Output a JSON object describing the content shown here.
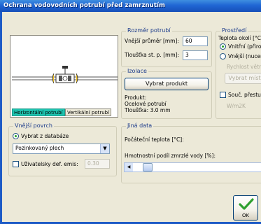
{
  "window": {
    "title": "Ochrana vodovodních potrubí před zamrznutím"
  },
  "pipe_size": {
    "title": "Rozměr potrubí",
    "outer_diameter_label": "Vnější průměr [mm]:",
    "outer_diameter_value": "60",
    "wall_thickness_label": "Tloušťka st. p. [mm]:",
    "wall_thickness_value": "3"
  },
  "environment": {
    "title": "Prostředí",
    "temp_label": "Teplota okolí [°C]:",
    "radio_inner": "Vnitřní (přiroz",
    "radio_outer": "Vnější (nucen",
    "disabled_label": "Rychlost větru",
    "disabled_button": "Vybrat místo",
    "check_label": "Souč. přestu",
    "disabled_value": "W/m2K"
  },
  "preview": {
    "tab_horizontal": "Horizontální potrubí",
    "tab_vertical": "Vertikální potrubí"
  },
  "insulation": {
    "title": "Izolace",
    "select_button": "Vybrat produkt",
    "product_line1": "Produkt:",
    "product_line2": "Ocelové potrubí",
    "product_line3": "Tloušťka: 3.0 mm"
  },
  "outer_surface": {
    "title": "Vnější povrch",
    "radio_db": "Vybrat z databáze",
    "material_value": "Pozinkovaný plech",
    "check_user": "Uživatelsky def. emis:",
    "user_value": "0.30"
  },
  "other_data": {
    "title": "Jiná data",
    "initial_temp_label": "Počáteční teplota [°C]:",
    "frozen_mass_label": "Hmotnostní podíl zmrzlé vody [%]:",
    "slider_fraction": 0.2
  },
  "ok_button": {
    "label": "OK"
  }
}
